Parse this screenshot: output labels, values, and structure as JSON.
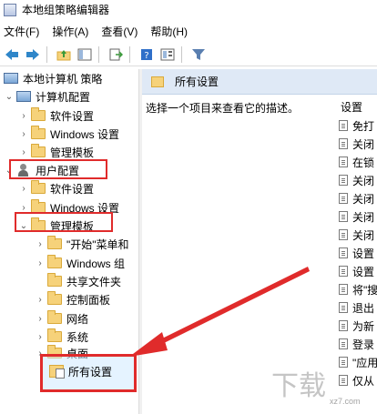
{
  "window": {
    "title": "本地组策略编辑器"
  },
  "menu": [
    {
      "label": "文件(F)"
    },
    {
      "label": "操作(A)"
    },
    {
      "label": "查看(V)"
    },
    {
      "label": "帮助(H)"
    }
  ],
  "toolbar": {
    "buttons": [
      {
        "icon": "back-arrow-icon"
      },
      {
        "icon": "forward-arrow-icon"
      },
      {
        "icon": "folder-up-icon"
      },
      {
        "icon": "show-hide-tree-icon"
      },
      {
        "icon": "export-list-icon"
      },
      {
        "icon": "help-icon"
      },
      {
        "icon": "properties-icon"
      },
      {
        "icon": "filter-icon"
      }
    ]
  },
  "tree": {
    "root": "本地计算机 策略",
    "computer_config": "计算机配置",
    "cc_software": "软件设置",
    "cc_windows": "Windows 设置",
    "cc_admin": "管理模板",
    "user_config": "用户配置",
    "uc_software": "软件设置",
    "uc_windows": "Windows 设置",
    "uc_admin": "管理模板",
    "at_start": "\"开始\"菜单和",
    "at_windows": "Windows 组",
    "at_shared": "共享文件夹",
    "at_control": "控制面板",
    "at_network": "网络",
    "at_system": "系统",
    "at_desktop": "桌面",
    "at_all": "所有设置"
  },
  "right_pane": {
    "header": "所有设置",
    "description": "选择一个项目来查看它的描述。",
    "column_header": "设置",
    "settings": [
      "免打",
      "关闭",
      "在锁",
      "关闭",
      "关闭",
      "关闭",
      "关闭",
      "设置",
      "设置",
      "将\"搜",
      "退出",
      "为新",
      "登录",
      "\"应用",
      "仅从"
    ]
  },
  "watermark": {
    "text": "xz7.com"
  },
  "colors": {
    "highlight": "#e02b2b",
    "header_bg": "#dfe9f6"
  }
}
